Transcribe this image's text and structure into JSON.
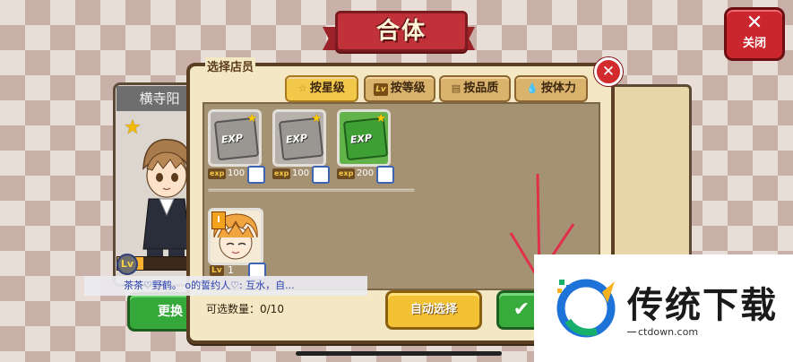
{
  "title": "合体",
  "close_top_label": "关闭",
  "character": {
    "name": "横寺阳",
    "lv_badge": "Lv"
  },
  "replace_button": "更换",
  "dialog": {
    "title": "选择店员",
    "sort_buttons": [
      {
        "label": "按星级",
        "icon": "star-icon",
        "active": true
      },
      {
        "label": "按等级",
        "icon": "lv-icon",
        "icon_text": "Lv",
        "active": false
      },
      {
        "label": "按品质",
        "icon": "book-icon",
        "active": false
      },
      {
        "label": "按体力",
        "icon": "drop-icon",
        "active": false
      }
    ],
    "exp_items": [
      {
        "tag": "exp",
        "value": "100",
        "color": "gray"
      },
      {
        "tag": "exp",
        "value": "100",
        "color": "gray"
      },
      {
        "tag": "exp",
        "value": "200",
        "color": "green"
      }
    ],
    "book_label": "EXP",
    "divider": "====================================================",
    "character_item": {
      "rank": "I",
      "lv_tag": "Lv",
      "level": "1"
    },
    "count_label": "可选数量：0/10",
    "auto_select_button": "自动选择"
  },
  "chat": {
    "text": "茶茶♡野鹤。 o的誓约人♡: 互水，自..."
  },
  "watermark": {
    "title": "传统下载",
    "subtitle": "ctdown.com"
  },
  "colors": {
    "accent_red": "#c9262d",
    "confirm_green": "#37ab3b",
    "auto_yellow": "#f2c234"
  }
}
